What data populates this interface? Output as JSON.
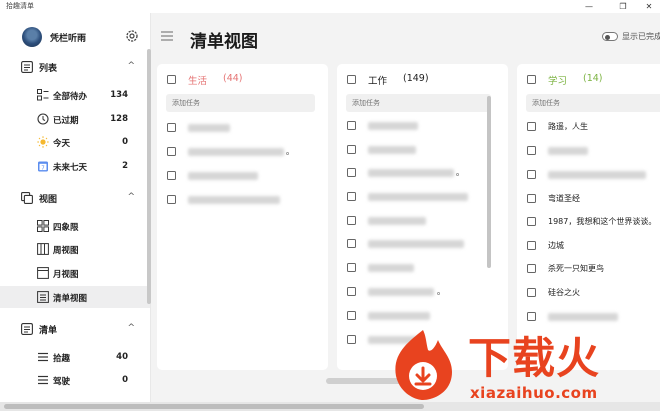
{
  "window": {
    "title": "拾趣清单",
    "minimize": "—",
    "maximize": "❐",
    "close": "✕"
  },
  "sidebar": {
    "user": {
      "name": "凭栏听雨"
    },
    "lists_section": {
      "label": "列表",
      "chevron": "^"
    },
    "lists": [
      {
        "label": "全部待办",
        "count": "134",
        "icon": "grid-list-icon"
      },
      {
        "label": "已过期",
        "count": "128",
        "icon": "clock-icon"
      },
      {
        "label": "今天",
        "count": "0",
        "icon": "sun-icon"
      },
      {
        "label": "未来七天",
        "count": "2",
        "icon": "calendar-7-icon"
      }
    ],
    "views_section": {
      "label": "视图",
      "chevron": "^"
    },
    "views": [
      {
        "label": "四象限",
        "icon": "quadrant-icon",
        "active": false
      },
      {
        "label": "周视图",
        "icon": "week-view-icon",
        "active": false
      },
      {
        "label": "月视图",
        "icon": "month-view-icon",
        "active": false
      },
      {
        "label": "清单视图",
        "icon": "list-view-icon",
        "active": true
      }
    ],
    "checklists_section": {
      "label": "清单",
      "chevron": "^"
    },
    "checklists": [
      {
        "label": "拾趣",
        "count": "40",
        "icon": "hamburger-list-icon"
      },
      {
        "label": "驾驶",
        "count": "0",
        "icon": "hamburger-list-icon"
      }
    ]
  },
  "main": {
    "title": "清单视图",
    "show_completed_label": "显示已完成",
    "columns": [
      {
        "name": "生活",
        "count": "(44)",
        "color": "#e57373",
        "add_placeholder": "添加任务",
        "tasks": [
          {
            "text": "",
            "blurred": true
          },
          {
            "text": "。",
            "blurred": true
          },
          {
            "text": "",
            "blurred": true
          },
          {
            "text": "",
            "blurred": true
          }
        ]
      },
      {
        "name": "工作",
        "count": "(149)",
        "color": "#222222",
        "add_placeholder": "添加任务",
        "tasks": [
          {
            "text": "",
            "blurred": true
          },
          {
            "text": "",
            "blurred": true
          },
          {
            "text": "。",
            "blurred": true
          },
          {
            "text": "",
            "blurred": true
          },
          {
            "text": "",
            "blurred": true
          },
          {
            "text": "",
            "blurred": true
          },
          {
            "text": "",
            "blurred": true
          },
          {
            "text": "。",
            "blurred": true
          },
          {
            "text": "",
            "blurred": true
          },
          {
            "text": "",
            "blurred": true
          }
        ]
      },
      {
        "name": "学习",
        "count": "(14)",
        "color": "#7cb342",
        "add_placeholder": "添加任务",
        "tasks": [
          {
            "text": "路遥，人生",
            "blurred": false
          },
          {
            "text": "",
            "blurred": true
          },
          {
            "text": "",
            "blurred": true
          },
          {
            "text": "弯道圣经",
            "blurred": false
          },
          {
            "text": "1987，我想和这个世界谈谈。",
            "blurred": false
          },
          {
            "text": "边城",
            "blurred": false
          },
          {
            "text": "杀死一只知更鸟",
            "blurred": false
          },
          {
            "text": "硅谷之火",
            "blurred": false
          },
          {
            "text": "",
            "blurred": true
          }
        ]
      }
    ]
  },
  "watermark": {
    "title": "下载火",
    "url": "xiazaihuo.com"
  }
}
